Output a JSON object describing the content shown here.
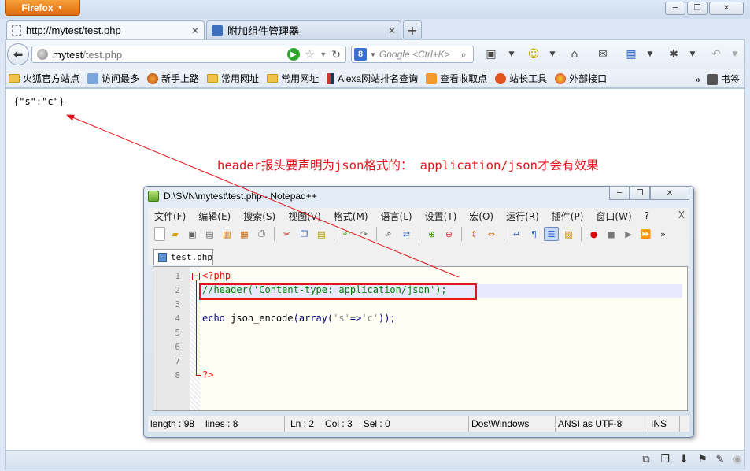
{
  "browser": {
    "menu_label": "Firefox",
    "window_buttons": {
      "minimize": "─",
      "restore": "❐",
      "close": "✕"
    },
    "tabs": [
      {
        "label": "http://mytest/test.php",
        "close": "✕"
      },
      {
        "label": "附加组件管理器",
        "close": "✕"
      }
    ],
    "new_tab": "+",
    "url": {
      "host": "mytest",
      "path": "/test.php"
    },
    "search_placeholder": "Google <Ctrl+K>",
    "bookmarks": [
      {
        "label": "火狐官方站点",
        "icon": "folder-icon"
      },
      {
        "label": "访问最多",
        "icon": "star-list-icon"
      },
      {
        "label": "新手上路",
        "icon": "firefox-icon"
      },
      {
        "label": "常用网址",
        "icon": "folder-icon"
      },
      {
        "label": "常用网址",
        "icon": "folder-icon"
      },
      {
        "label": "Alexa网站排名查询",
        "icon": "alexa-icon"
      },
      {
        "label": "查看收取点",
        "icon": "rss-icon"
      },
      {
        "label": "站长工具",
        "icon": "chinaz-icon"
      },
      {
        "label": "外部接口",
        "icon": "flower-icon"
      }
    ],
    "bookmarks_overflow": "»",
    "bookmarks_menu": "书签",
    "page_output": "{\"s\":\"c\"}",
    "accent": "#e06a0c"
  },
  "annotation": {
    "text": "header报头要声明为json格式的：  application/json才会有效果",
    "color": "#e0151b"
  },
  "notepad": {
    "title": "D:\\SVN\\mytest\\test.php - Notepad++",
    "window_buttons": {
      "minimize": "─",
      "restore": "❐",
      "close": "✕"
    },
    "menu": [
      "文件(F)",
      "编辑(E)",
      "搜索(S)",
      "视图(V)",
      "格式(M)",
      "语言(L)",
      "设置(T)",
      "宏(O)",
      "运行(R)",
      "插件(P)",
      "窗口(W)",
      "?"
    ],
    "menu_close": "X",
    "toolbar_overflow": "»",
    "tab": "test.php",
    "line_numbers": [
      "1",
      "2",
      "3",
      "4",
      "5",
      "6",
      "7",
      "8"
    ],
    "code": {
      "l1": "<?php",
      "l2": "//header('Content-type: application/json');",
      "l4_echo": "echo",
      "l4_fn": " json_encode",
      "l4_p1": "(",
      "l4_array": "array",
      "l4_p2": "(",
      "l4_s": "'s'",
      "l4_op": "=>",
      "l4_c": "'c'",
      "l4_end": "));",
      "l8": "?>"
    },
    "status": {
      "length": "length : 98",
      "lines": "lines : 8",
      "ln": "Ln : 2",
      "col": "Col : 3",
      "sel": "Sel : 0",
      "eol": "Dos\\Windows",
      "encoding": "ANSI as UTF-8",
      "mode": "INS"
    }
  }
}
